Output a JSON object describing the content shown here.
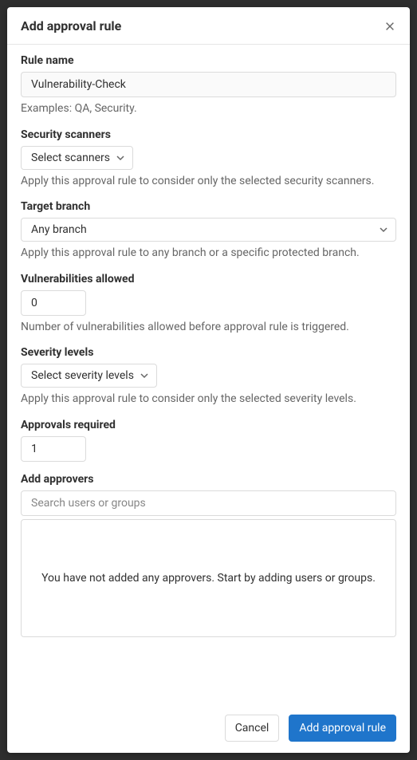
{
  "modal": {
    "title": "Add approval rule"
  },
  "ruleName": {
    "label": "Rule name",
    "value": "Vulnerability-Check",
    "help": "Examples: QA, Security."
  },
  "scanners": {
    "label": "Security scanners",
    "buttonText": "Select scanners",
    "help": "Apply this approval rule to consider only the selected security scanners."
  },
  "targetBranch": {
    "label": "Target branch",
    "buttonText": "Any branch",
    "help": "Apply this approval rule to any branch or a specific protected branch."
  },
  "vulnerabilities": {
    "label": "Vulnerabilities allowed",
    "value": "0",
    "help": "Number of vulnerabilities allowed before approval rule is triggered."
  },
  "severity": {
    "label": "Severity levels",
    "buttonText": "Select severity levels",
    "help": "Apply this approval rule to consider only the selected severity levels."
  },
  "approvalsRequired": {
    "label": "Approvals required",
    "value": "1"
  },
  "approvers": {
    "label": "Add approvers",
    "placeholder": "Search users or groups",
    "emptyText": "You have not added any approvers. Start by adding users or groups."
  },
  "footer": {
    "cancel": "Cancel",
    "submit": "Add approval rule"
  }
}
